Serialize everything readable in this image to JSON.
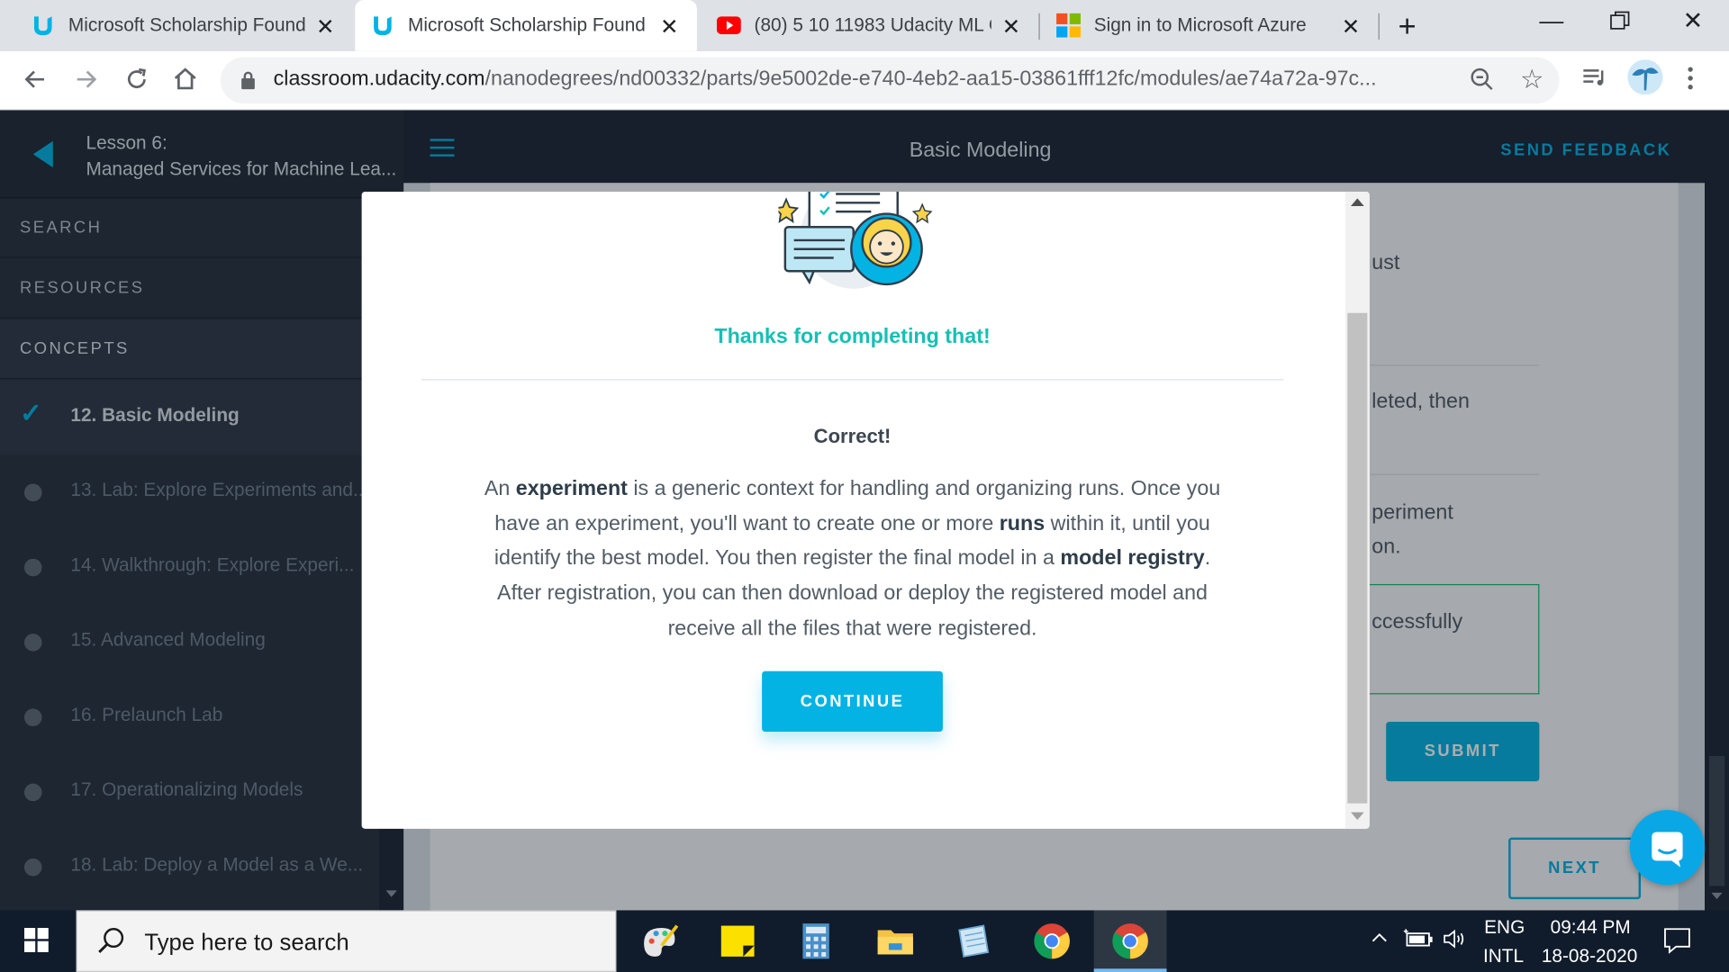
{
  "browser": {
    "tabs": [
      {
        "title": "Microsoft Scholarship Found",
        "favicon": "udacity-icon",
        "active": false
      },
      {
        "title": "Microsoft Scholarship Found",
        "favicon": "udacity-icon",
        "active": true
      },
      {
        "title": "(80) 5 10 11983 Udacity ML C",
        "favicon": "youtube-icon",
        "active": false
      },
      {
        "title": "Sign in to Microsoft Azure",
        "favicon": "microsoft-icon",
        "active": false
      }
    ],
    "url_host": "classroom.udacity.com",
    "url_path": "/nanodegrees/nd00332/parts/9e5002de-e740-4eb2-aa15-03861fff12fc/modules/ae74a72a-97c..."
  },
  "lesson": {
    "label": "Lesson 6:",
    "name": "Managed Services for Machine Lea..."
  },
  "header": {
    "title": "Basic Modeling",
    "feedback": "SEND FEEDBACK"
  },
  "sidebar": {
    "search": "SEARCH",
    "resources": "RESOURCES",
    "concepts": "CONCEPTS",
    "items": [
      {
        "label": "12. Basic Modeling",
        "state": "complete"
      },
      {
        "label": "13. Lab: Explore Experiments and...",
        "state": "todo"
      },
      {
        "label": "14. Walkthrough: Explore Experi...",
        "state": "todo"
      },
      {
        "label": "15. Advanced Modeling",
        "state": "todo"
      },
      {
        "label": "16. Prelaunch Lab",
        "state": "todo"
      },
      {
        "label": "17. Operationalizing Models",
        "state": "todo"
      },
      {
        "label": "18. Lab: Deploy a Model as a We...",
        "state": "todo"
      }
    ]
  },
  "background": {
    "fragments": [
      "ust",
      "leted, then",
      "periment",
      "on.",
      "ccessfully"
    ],
    "submit": "SUBMIT",
    "next": "NEXT"
  },
  "modal": {
    "thanks": "Thanks for completing that!",
    "correct": "Correct!",
    "para": {
      "t1": "An ",
      "b1": "experiment",
      "t2": " is a generic context for handling and organizing runs. Once you have an experiment, you'll want to create one or more ",
      "b2": "runs",
      "t3": " within it, until you identify the best model. You then register the final model in a ",
      "b3": "model registry",
      "t4": ". After registration, you can then download or deploy the registered model and receive all the files that were registered."
    },
    "continue": "CONTINUE"
  },
  "taskbar": {
    "search_placeholder": "Type here to search",
    "lang1": "ENG",
    "lang2": "INTL",
    "time": "09:44 PM",
    "date": "18-08-2020"
  },
  "colors": {
    "accent": "#02b3e4",
    "success": "#15c0b3",
    "sidebar": "#26303d"
  }
}
